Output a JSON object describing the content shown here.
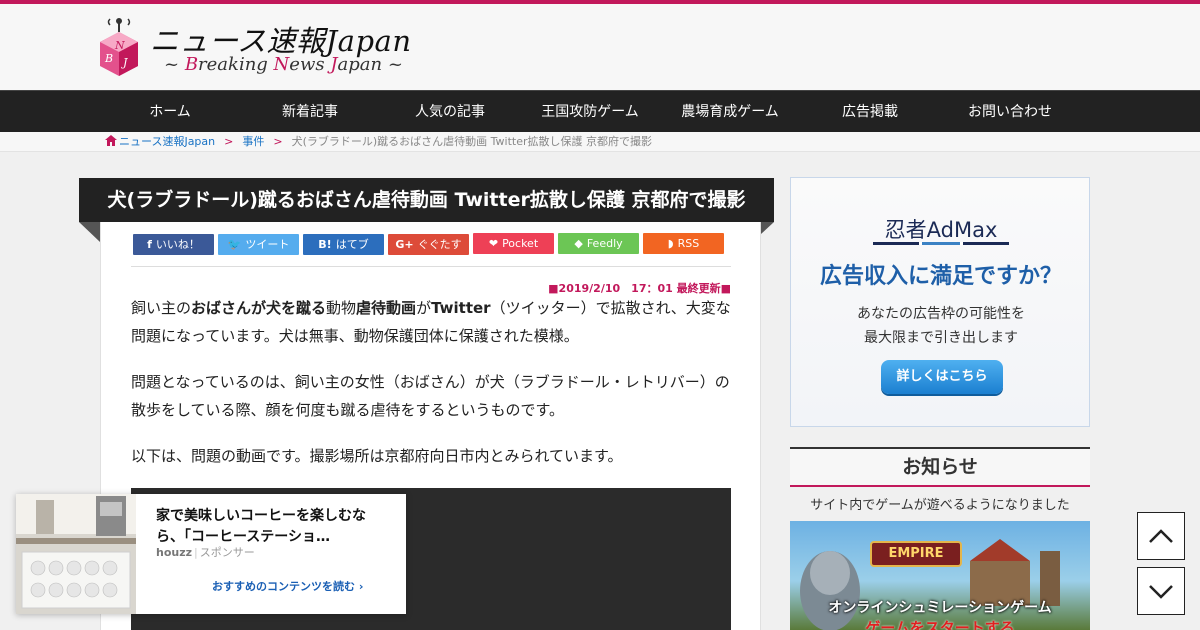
{
  "site": {
    "logo_letters": [
      "B",
      "N",
      "J"
    ],
    "title": "ニュース速報Japan",
    "subtitle": {
      "prefix": "~ ",
      "b_accent": "B",
      "b_rest": "reaking ",
      "n_accent": "N",
      "n_rest": "ews ",
      "j_accent": "J",
      "j_rest": "apan",
      "suffix": " ~"
    },
    "accent_color": "#c2185b"
  },
  "nav": {
    "items": [
      {
        "label": "ホーム"
      },
      {
        "label": "新着記事"
      },
      {
        "label": "人気の記事"
      },
      {
        "label": "王国攻防ゲーム"
      },
      {
        "label": "農場育成ゲーム"
      },
      {
        "label": "広告掲載"
      },
      {
        "label": "お問い合わせ"
      }
    ]
  },
  "breadcrumb": {
    "home": "ニュース速報Japan",
    "separator": ">",
    "category": "事件",
    "current": "犬(ラブラドール)蹴るおばさん虐待動画 Twitter拡散し保護 京都府で撮影"
  },
  "article": {
    "title": "犬(ラブラドール)蹴るおばさん虐待動画 Twitter拡散し保護 京都府で撮影",
    "share": [
      {
        "label": "いいね！",
        "icon": "facebook-icon",
        "glyph": "f",
        "color": "#3b5998"
      },
      {
        "label": "ツイート",
        "icon": "twitter-icon",
        "glyph": "🐦",
        "color": "#55acee"
      },
      {
        "label": "はてブ",
        "icon": "hatena-icon",
        "glyph": "B!",
        "color": "#2c6ebd"
      },
      {
        "label": "ぐぐたす",
        "icon": "google-plus-icon",
        "glyph": "G+",
        "color": "#dd4b39"
      },
      {
        "label": "Pocket",
        "icon": "pocket-icon",
        "glyph": "❤",
        "color": "#ee4056"
      },
      {
        "label": "Feedly",
        "icon": "feedly-icon",
        "glyph": "◆",
        "color": "#6cc655"
      },
      {
        "label": "RSS",
        "icon": "rss-icon",
        "glyph": "◗",
        "color": "#f26522"
      }
    ],
    "updated": "■2019/2/10　17：01 最終更新■",
    "p1": {
      "a": "飼い主の",
      "b": "おばさんが犬を蹴る",
      "c": "動物",
      "d": "虐待動画",
      "e": "が",
      "f": "Twitter",
      "g": "（ツイッター）で拡散され、大変な問題になっています。犬は無事、動物保護団体に保護された模様。"
    },
    "p2": "問題となっているのは、飼い主の女性（おばさん）が犬（ラブラドール・レトリバー）の散歩をしている際、顔を何度も蹴る虐待をするというものです。",
    "p3": "以下は、問題の動画です。撮影場所は京都府向日市内とみられています。"
  },
  "native_ad": {
    "title": "家で美味しいコーヒーを楽しむなら、「コーヒーステーショ…",
    "brand": "houzz",
    "divider": "|",
    "sponsor": "スポンサー",
    "cta": "おすすめのコンテンツを読む ›"
  },
  "side_ad": {
    "brand": "忍者AdMax",
    "headline": "広告収入に満足ですか？",
    "body_line1": "あなたの広告枠の可能性を",
    "body_line2": "最大限まで引き出します",
    "button": "詳しくはこちら"
  },
  "notice": {
    "heading": "お知らせ",
    "text": "サイト内でゲームが遊べるようになりました",
    "game_logo": "EMPIRE",
    "game_caption": "オンラインシュミレーションゲーム",
    "game_cta": "ゲームをスタートする"
  }
}
